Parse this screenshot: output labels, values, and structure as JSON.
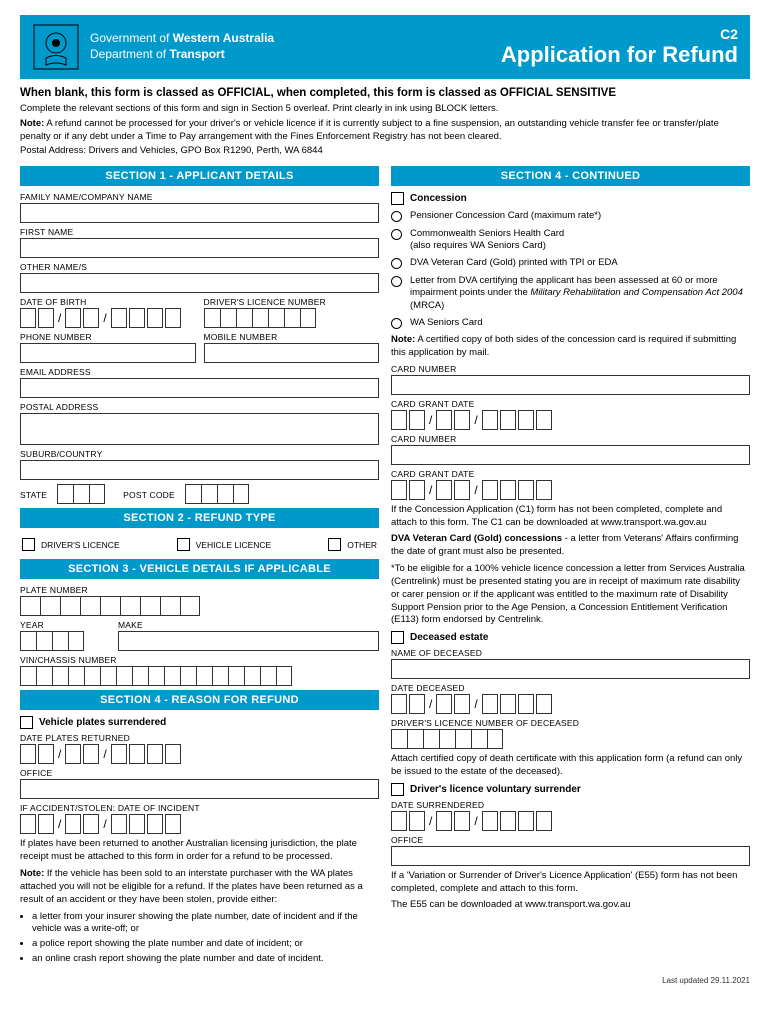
{
  "header": {
    "gov_line1_prefix": "Government of ",
    "gov_line1_bold": "Western Australia",
    "gov_line2_prefix": "Department of ",
    "gov_line2_bold": "Transport",
    "form_code": "C2",
    "form_title": "Application for Refund"
  },
  "classification": "When blank, this form is classed as OFFICIAL, when completed, this form is classed as OFFICIAL SENSITIVE",
  "instructions_line1": "Complete the relevant sections of this form and sign in Section 5 overleaf. Print clearly in ink using BLOCK letters.",
  "note_label": "Note:",
  "instructions_note": " A refund cannot be processed for your driver's or vehicle licence if it is currently subject to a fine suspension, an outstanding vehicle transfer fee or transfer/plate penalty or if any debt under a Time to Pay arrangement with the Fines Enforcement Registry has not been cleared.",
  "postal_address": "Postal Address: Drivers and Vehicles, GPO Box R1290, Perth, WA 6844",
  "section1": {
    "title": "SECTION 1 - APPLICANT DETAILS",
    "family_name": "FAMILY NAME/COMPANY NAME",
    "first_name": "FIRST NAME",
    "other_names": "OTHER NAME/S",
    "dob": "DATE OF BIRTH",
    "licence_no": "DRIVER'S LICENCE NUMBER",
    "phone": "PHONE NUMBER",
    "mobile": "MOBILE NUMBER",
    "email": "EMAIL ADDRESS",
    "postal": "POSTAL ADDRESS",
    "suburb": "SUBURB/COUNTRY",
    "state": "STATE",
    "postcode": "POST CODE"
  },
  "section2": {
    "title": "SECTION 2 - REFUND TYPE",
    "drivers": "DRIVER'S LICENCE",
    "vehicle": "VEHICLE LICENCE",
    "other": "OTHER"
  },
  "section3": {
    "title": "SECTION 3 - VEHICLE DETAILS IF APPLICABLE",
    "plate": "PLATE NUMBER",
    "year": "YEAR",
    "make": "MAKE",
    "vin": "VIN/CHASSIS NUMBER"
  },
  "section4": {
    "title": "SECTION 4 - REASON FOR REFUND",
    "title_cont": "SECTION 4 - CONTINUED",
    "plates_surrendered": "Vehicle plates surrendered",
    "date_returned": "DATE PLATES RETURNED",
    "office": "OFFICE",
    "incident_date": "IF ACCIDENT/STOLEN: DATE OF INCIDENT",
    "plates_text": "If plates have been returned to another Australian licensing jurisdiction, the plate receipt must be attached to this form in order for a refund to be processed.",
    "plates_note": " If the vehicle has been sold to an interstate purchaser with the WA plates attached you will not be eligible for a refund. If the plates have been returned as a result of an accident or they have been stolen, provide either:",
    "bullets": [
      "a letter from your insurer showing the plate number, date of incident and if the vehicle was a write-off; or",
      "a police report showing the plate number and date of incident; or",
      "an online crash report showing the plate number and date of incident."
    ],
    "concession": "Concession",
    "radio1": "Pensioner Concession Card (maximum rate*)",
    "radio2a": "Commonwealth Seniors Health Card",
    "radio2b": "(also requires WA Seniors Card)",
    "radio3": "DVA Veteran Card (Gold) printed with TPI or EDA",
    "radio4a": "Letter from DVA certifying the applicant has been assessed at 60 or more impairment points under the ",
    "radio4b": "Military Rehabilitation and Compensation Act 2004",
    "radio4c": " (MRCA)",
    "radio5": "WA Seniors Card",
    "concession_note": " A certified copy of both sides of the concession card is required if submitting this application by mail.",
    "card_number": "CARD NUMBER",
    "card_grant": "CARD GRANT DATE",
    "c1_text": "If the Concession Application (C1) form has not been completed, complete and attach to this form. The C1 can be downloaded at www.transport.wa.gov.au",
    "dva_bold": "DVA Veteran Card (Gold) concessions",
    "dva_text": " - a letter from Veterans' Affairs confirming the date of grant must also be presented.",
    "eligible_text": "*To be eligible for a 100% vehicle licence concession a letter from Services Australia (Centrelink) must be presented stating you are in receipt of maximum rate disability or carer pension or if the applicant was entitled to the maximum rate of Disability Support Pension prior to the Age Pension, a Concession Entitlement Verification (E113) form endorsed by Centrelink.",
    "deceased": "Deceased estate",
    "name_deceased": "NAME OF DECEASED",
    "date_deceased": "DATE DECEASED",
    "licence_deceased": "DRIVER'S LICENCE NUMBER OF DECEASED",
    "deceased_text": "Attach certified copy of death certificate with this application form (a refund can only be issued to the estate of the deceased).",
    "voluntary": "Driver's licence voluntary surrender",
    "date_surrendered": "DATE SURRENDERED",
    "e55_text1": "If a 'Variation or Surrender of Driver's Licence Application' (E55) form has not been completed, complete and attach to this form.",
    "e55_text2": "The E55 can be downloaded at www.transport.wa.gov.au"
  },
  "footer_date": "Last updated 29.11.2021"
}
